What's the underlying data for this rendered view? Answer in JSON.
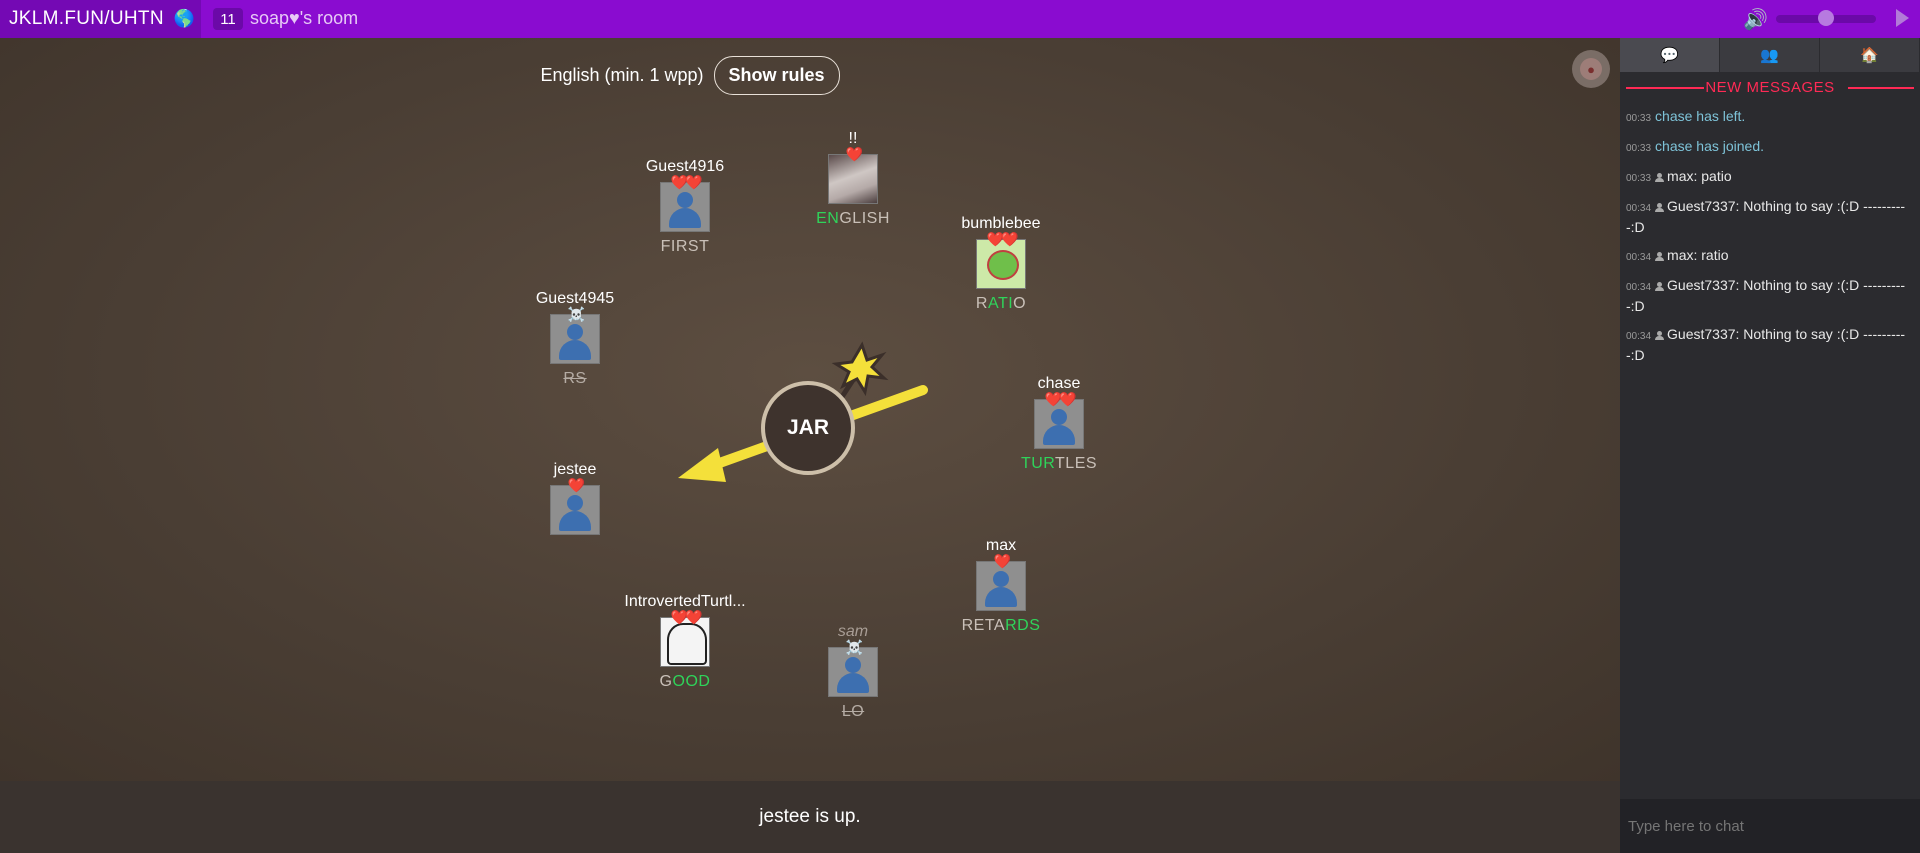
{
  "topbar": {
    "room_code": "JKLM.FUN/UHTN",
    "globe_icon": "🌎",
    "player_count": "11",
    "room_name": "soap♥'s room",
    "volume_icon": "🔊"
  },
  "game": {
    "language": "English (min. 1 wpp)",
    "show_rules_label": "Show rules",
    "bomb_syllable": "JAR",
    "status": "jestee is up."
  },
  "players": [
    {
      "name": "!!",
      "hearts": "❤️",
      "avatar": "cat-photo",
      "word_hl": "EN",
      "word_rest": "GLISH"
    },
    {
      "name": "Guest4916",
      "hearts": "❤️❤️",
      "avatar": "default",
      "word_hl": "",
      "word_rest": "FIRST"
    },
    {
      "name": "bumblebee",
      "hearts": "❤️❤️",
      "avatar": "frog-photo",
      "word_pre": "R",
      "word_hl": "ATI",
      "word_rest": "O"
    },
    {
      "name": "Guest4945",
      "hearts": "☠️",
      "avatar": "default",
      "word_rest": "RS"
    },
    {
      "name": "chase",
      "hearts": "❤️❤️",
      "avatar": "default",
      "word_hl": "TUR",
      "word_rest": "TLES"
    },
    {
      "name": "jestee",
      "hearts": "❤️",
      "avatar": "default",
      "word_rest": ""
    },
    {
      "name": "max",
      "hearts": "❤️",
      "avatar": "default",
      "word_pre": "RETA",
      "word_hl": "RDS",
      "word_rest": ""
    },
    {
      "name": "IntrovertedTurtl...",
      "hearts": "❤️❤️",
      "avatar": "sketch-photo",
      "word_pre": "G",
      "word_hl": "OOD",
      "word_rest": ""
    },
    {
      "name": "sam",
      "hearts": "☠️",
      "avatar": "default",
      "word_rest": "LO"
    }
  ],
  "sidebar": {
    "tabs": [
      "💬",
      "👥",
      "🏠"
    ],
    "new_messages_label": "NEW MESSAGES",
    "messages": [
      {
        "time": "00:33",
        "type": "system",
        "text": "chase has left."
      },
      {
        "time": "00:33",
        "type": "system",
        "text": "chase has joined."
      },
      {
        "time": "00:33",
        "type": "user",
        "author": "max",
        "text": ": patio"
      },
      {
        "time": "00:34",
        "type": "user",
        "author": "Guest7337",
        "text": ": Nothing to say :(:D ----------:D"
      },
      {
        "time": "00:34",
        "type": "user",
        "author": "max",
        "text": ": ratio"
      },
      {
        "time": "00:34",
        "type": "user",
        "author": "Guest7337",
        "text": ": Nothing to say :(:D ----------:D"
      },
      {
        "time": "00:34",
        "type": "user",
        "author": "Guest7337",
        "text": ": Nothing to say :(:D ----------:D"
      }
    ],
    "chat_placeholder": "Type here to chat"
  }
}
